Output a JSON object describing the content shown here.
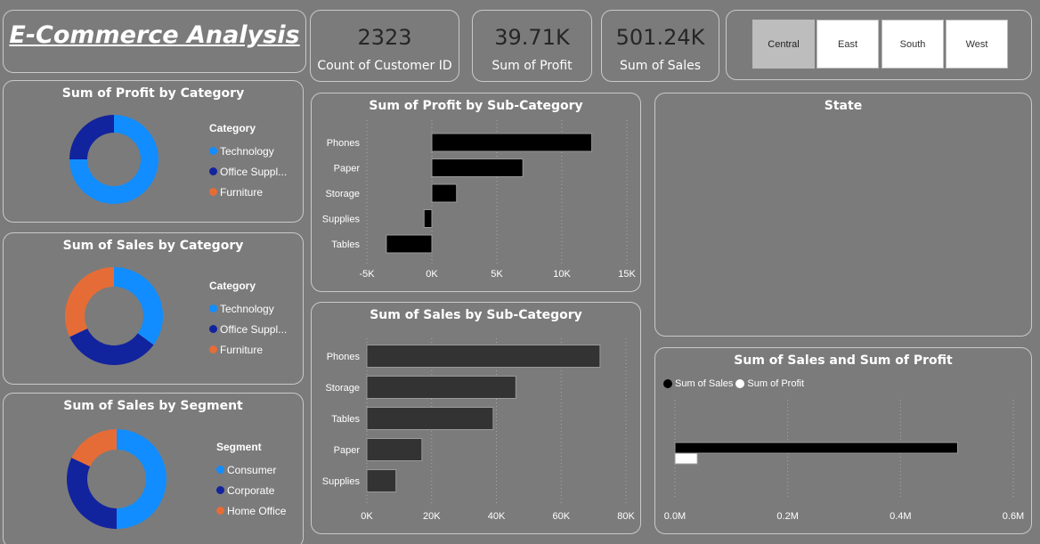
{
  "header": {
    "title": "E-Commerce Analysis"
  },
  "kpis": [
    {
      "value": "2323",
      "label": "Count of Customer ID"
    },
    {
      "value": "39.71K",
      "label": "Sum of Profit"
    },
    {
      "value": "501.24K",
      "label": "Sum of Sales"
    }
  ],
  "region_slicer": {
    "options": [
      "Central",
      "East",
      "South",
      "West"
    ],
    "selected": "Central"
  },
  "profit_by_category": {
    "title": "Sum of Profit by Category",
    "legend_title": "Category",
    "legend": [
      {
        "label": "Technology",
        "color": "#118dff"
      },
      {
        "label": "Office Suppl...",
        "color": "#12239e"
      },
      {
        "label": "Furniture",
        "color": "#e66c37"
      }
    ]
  },
  "sales_by_category": {
    "title": "Sum of Sales by Category",
    "legend_title": "Category",
    "legend": [
      {
        "label": "Technology",
        "color": "#118dff"
      },
      {
        "label": "Office Suppl...",
        "color": "#12239e"
      },
      {
        "label": "Furniture",
        "color": "#e66c37"
      }
    ]
  },
  "sales_by_segment": {
    "title": "Sum of Sales by Segment",
    "legend_title": "Segment",
    "legend": [
      {
        "label": "Consumer",
        "color": "#118dff"
      },
      {
        "label": "Corporate",
        "color": "#12239e"
      },
      {
        "label": "Home Office",
        "color": "#e66c37"
      }
    ]
  },
  "profit_by_subcat": {
    "title": "Sum of Profit by Sub-Category"
  },
  "sales_by_subcat": {
    "title": "Sum of Sales by Sub-Category"
  },
  "state_map": {
    "title": "State"
  },
  "sales_and_profit": {
    "title": "Sum of Sales and Sum of Profit",
    "legend": [
      {
        "label": "Sum of Sales",
        "color": "#000000"
      },
      {
        "label": "Sum of Profit",
        "color": "#ffffff"
      }
    ]
  },
  "chart_data": [
    {
      "type": "pie",
      "title": "Sum of Profit by Category",
      "categories": [
        "Technology",
        "Office Supplies",
        "Furniture"
      ],
      "values": [
        75,
        25,
        0
      ],
      "colors": [
        "#118dff",
        "#12239e",
        "#e66c37"
      ]
    },
    {
      "type": "pie",
      "title": "Sum of Sales by Category",
      "categories": [
        "Technology",
        "Office Supplies",
        "Furniture"
      ],
      "values": [
        35,
        33,
        32
      ],
      "colors": [
        "#118dff",
        "#12239e",
        "#e66c37"
      ]
    },
    {
      "type": "pie",
      "title": "Sum of Sales by Segment",
      "categories": [
        "Consumer",
        "Corporate",
        "Home Office"
      ],
      "values": [
        50,
        32,
        18
      ],
      "colors": [
        "#118dff",
        "#12239e",
        "#e66c37"
      ]
    },
    {
      "type": "bar",
      "title": "Sum of Profit by Sub-Category",
      "categories": [
        "Phones",
        "Paper",
        "Storage",
        "Supplies",
        "Tables"
      ],
      "values": [
        12300,
        7000,
        1900,
        -600,
        -3500
      ],
      "xlim": [
        -5000,
        15000
      ],
      "ticks": [
        -5000,
        0,
        5000,
        10000,
        15000
      ],
      "tick_labels": [
        "-5K",
        "0K",
        "5K",
        "10K",
        "15K"
      ],
      "bar_color": "#000000"
    },
    {
      "type": "bar",
      "title": "Sum of Sales by Sub-Category",
      "categories": [
        "Phones",
        "Storage",
        "Tables",
        "Paper",
        "Supplies"
      ],
      "values": [
        72000,
        46000,
        39000,
        17000,
        9000
      ],
      "xlim": [
        0,
        80000
      ],
      "ticks": [
        0,
        20000,
        40000,
        60000,
        80000
      ],
      "tick_labels": [
        "0K",
        "20K",
        "40K",
        "60K",
        "80K"
      ],
      "bar_color": "#333333"
    },
    {
      "type": "bar",
      "title": "Sum of Sales and Sum of Profit",
      "series": [
        {
          "name": "Sum of Sales",
          "values": [
            501240
          ],
          "color": "#000000"
        },
        {
          "name": "Sum of Profit",
          "values": [
            39710
          ],
          "color": "#ffffff"
        }
      ],
      "xlim": [
        0,
        600000
      ],
      "ticks": [
        0,
        200000,
        400000,
        600000
      ],
      "tick_labels": [
        "0.0M",
        "0.2M",
        "0.4M",
        "0.6M"
      ]
    }
  ]
}
